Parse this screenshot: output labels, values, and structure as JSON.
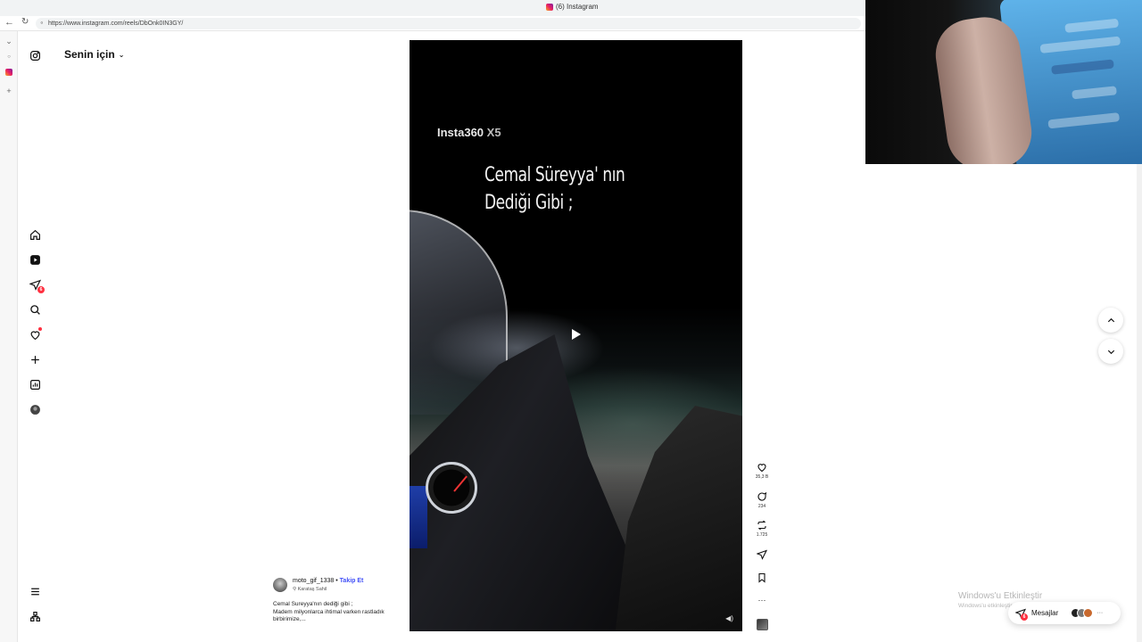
{
  "browser": {
    "tab_title": "(6) Instagram",
    "url": "https://www.instagram.com/reels/DbOnk0IN3GY/"
  },
  "feed": {
    "header_label": "Senin için"
  },
  "sidebar": {
    "items": [
      {
        "name": "home-icon"
      },
      {
        "name": "reels-icon"
      },
      {
        "name": "messages-icon",
        "badge": "6"
      },
      {
        "name": "search-icon"
      },
      {
        "name": "notifications-icon"
      },
      {
        "name": "create-icon"
      },
      {
        "name": "dashboard-icon"
      },
      {
        "name": "profile-avatar"
      }
    ]
  },
  "reel": {
    "brand": "Insta360",
    "brand_model": "X5",
    "caption_line1": "Cemal Süreyya' nın",
    "caption_line2": "Dediği Gibi ;"
  },
  "actions": {
    "likes": "35,3 B",
    "comments": "234",
    "reposts": "1.725"
  },
  "author": {
    "username": "moto_gif_1338",
    "separator": " • ",
    "follow_label": "Takip Et",
    "location": "Karataş Sahil",
    "description_line1": "Cemal Sureyya'nın dediği gibi ;",
    "description_line2": "Madem milyonlarca ihtimal varken rastladık",
    "description_line3": "birbirimize,..."
  },
  "watermark": {
    "title": "Windows'u Etkinleştir",
    "subtitle": "Windows'u etkinleştirmek için Ayarlar'a"
  },
  "messages": {
    "label": "Mesajlar",
    "badge": "6",
    "more": "···"
  },
  "colors": {
    "accent_blue": "#4150f7",
    "badge_red": "#ff3040"
  }
}
